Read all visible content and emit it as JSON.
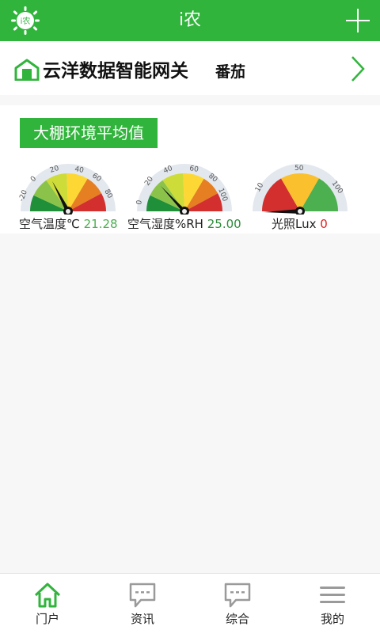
{
  "app": {
    "title": "i农",
    "logo_text": "i农"
  },
  "gateway": {
    "name": "云洋数据智能网关",
    "crop": "番茄"
  },
  "environment": {
    "title": "大棚环境平均值",
    "gauges": [
      {
        "label": "空气温度℃",
        "value": "21.28",
        "ticks": [
          "-20",
          "0",
          "20",
          "40",
          "60",
          "80"
        ]
      },
      {
        "label": "空气湿度%RH",
        "value": "25.00",
        "ticks": [
          "0",
          "20",
          "40",
          "60",
          "80",
          "100"
        ]
      },
      {
        "label": "光照Lux",
        "value": "0",
        "ticks": [
          "10",
          "50",
          "100"
        ]
      }
    ]
  },
  "nav": {
    "items": [
      {
        "label": "门户",
        "icon": "home-icon",
        "active": true
      },
      {
        "label": "资讯",
        "icon": "chat-icon",
        "active": false
      },
      {
        "label": "综合",
        "icon": "chat-icon",
        "active": false
      },
      {
        "label": "我的",
        "icon": "menu-icon",
        "active": false
      }
    ]
  },
  "colors": {
    "brand": "#31b43c",
    "active_nav": "#31b43c",
    "inactive_nav": "#9a9a9a"
  }
}
